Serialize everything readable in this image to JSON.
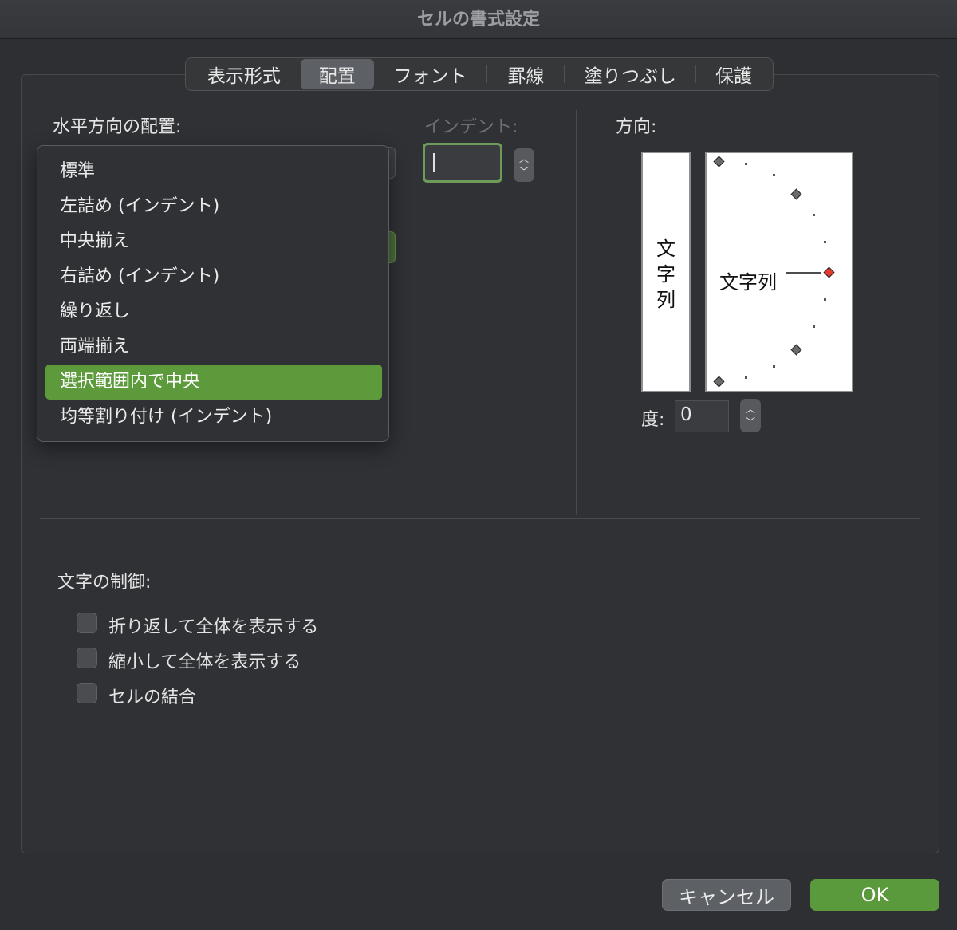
{
  "window": {
    "title": "セルの書式設定"
  },
  "tabs": [
    {
      "label": "表示形式"
    },
    {
      "label": "配置"
    },
    {
      "label": "フォント"
    },
    {
      "label": "罫線"
    },
    {
      "label": "塗りつぶし"
    },
    {
      "label": "保護"
    }
  ],
  "active_tab": "配置",
  "alignment": {
    "horizontal_label": "水平方向の配置:",
    "indent_label": "インデント:",
    "indent_value": "",
    "horizontal_options": [
      {
        "label": "標準"
      },
      {
        "label": "左詰め (インデント)"
      },
      {
        "label": "中央揃え"
      },
      {
        "label": "右詰め (インデント)"
      },
      {
        "label": "繰り返し"
      },
      {
        "label": "両端揃え"
      },
      {
        "label": "選択範囲内で中央"
      },
      {
        "label": "均等割り付け (インデント)"
      }
    ],
    "selected_horizontal": "選択範囲内で中央"
  },
  "orientation": {
    "label": "方向:",
    "vertical_text": [
      "文",
      "字",
      "列"
    ],
    "horizontal_text": "文字列",
    "degree_label": "度:",
    "degree_value": "0"
  },
  "text_control": {
    "label": "文字の制御:",
    "options": [
      {
        "label": "折り返して全体を表示する",
        "checked": false
      },
      {
        "label": "縮小して全体を表示する",
        "checked": false
      },
      {
        "label": "セルの結合",
        "checked": false
      }
    ]
  },
  "buttons": {
    "cancel": "キャンセル",
    "ok": "OK"
  },
  "colors": {
    "accent": "#5b9a3c",
    "focus_ring": "#6e9a5a",
    "indicator": "#e53b2d"
  }
}
